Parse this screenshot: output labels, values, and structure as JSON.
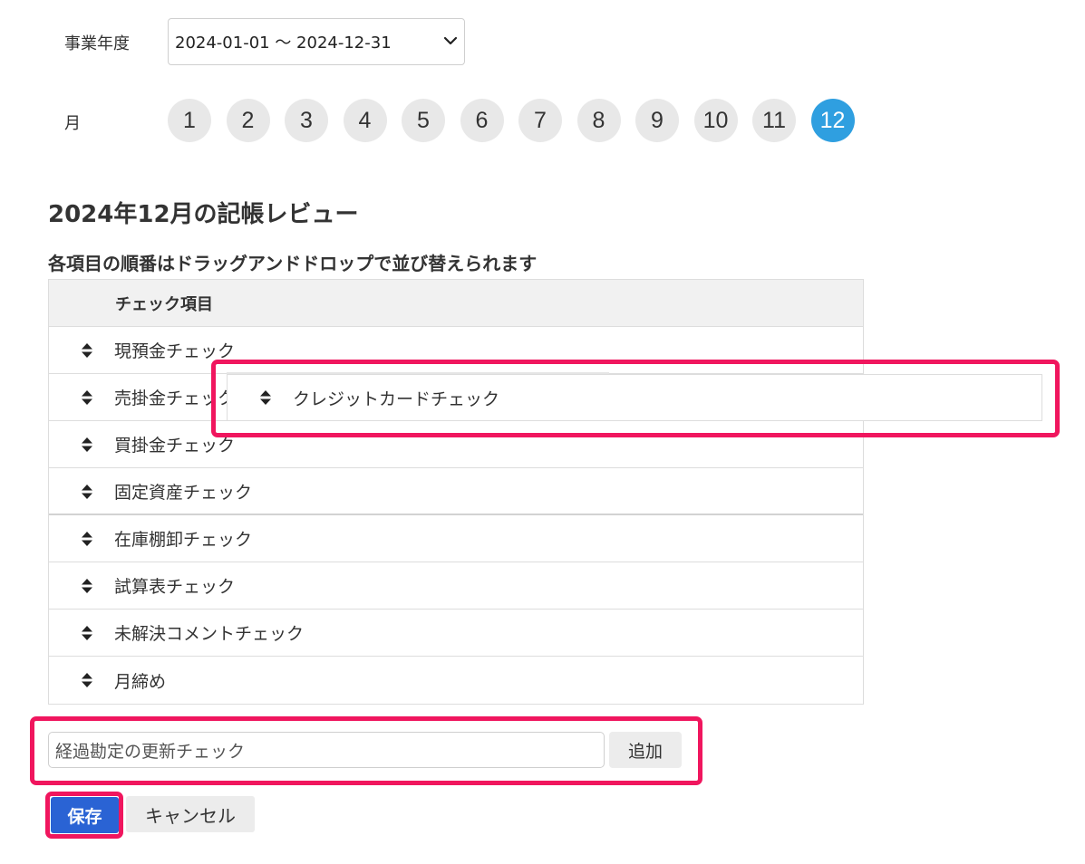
{
  "fiscal_year": {
    "label": "事業年度",
    "selected": "2024-01-01 〜 2024-12-31"
  },
  "month": {
    "label": "月",
    "options": [
      "1",
      "2",
      "3",
      "4",
      "5",
      "6",
      "7",
      "8",
      "9",
      "10",
      "11",
      "12"
    ],
    "active": "12"
  },
  "review": {
    "title": "2024年12月の記帳レビュー",
    "subtitle": "各項目の順番はドラッグアンドドロップで並び替えられます",
    "column_header": "チェック項目",
    "items": [
      "現預金チェック",
      "売掛金チェック",
      "買掛金チェック",
      "固定資産チェック",
      "在庫棚卸チェック",
      "試算表チェック",
      "未解決コメントチェック",
      "月締め"
    ],
    "dragging_item": "クレジットカードチェック"
  },
  "add_item": {
    "input_value": "経過勘定の更新チェック",
    "button_label": "追加"
  },
  "actions": {
    "save_label": "保存",
    "cancel_label": "キャンセル"
  },
  "colors": {
    "accent": "#2f9fe0",
    "primary_button": "#2a63d4",
    "highlight": "#f0165e"
  }
}
